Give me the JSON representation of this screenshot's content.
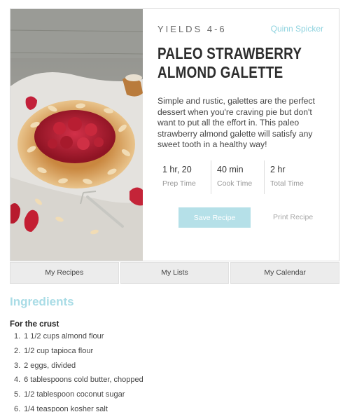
{
  "recipe": {
    "yields": "YIELDS 4-6",
    "author": "Quinn Spicker",
    "title": "PALEO STRAWBERRY ALMOND GALETTE",
    "description": "Simple and rustic, galettes are the perfect dessert when you're craving pie but don't want to put all the effort in. This paleo strawberry almond galette will satisfy any sweet tooth in a healthy way!",
    "photo_icon": "galette-photo"
  },
  "times": [
    {
      "value": "1 hr, 20",
      "label": "Prep Time"
    },
    {
      "value": "40 min",
      "label": "Cook Time"
    },
    {
      "value": "2 hr",
      "label": "Total Time"
    }
  ],
  "actions": {
    "save_label": "Save Recipe",
    "print_label": "Print Recipe"
  },
  "tabs": [
    "My Recipes",
    "My Lists",
    "My Calendar"
  ],
  "ingredients": {
    "heading": "Ingredients",
    "group": "For the crust",
    "items": [
      {
        "num": "1.",
        "text": "1 1/2 cups almond flour"
      },
      {
        "num": "2.",
        "text": "1/2 cup tapioca flour"
      },
      {
        "num": "3.",
        "text": "2 eggs, divided"
      },
      {
        "num": "4.",
        "text": "6 tablespoons cold butter, chopped"
      },
      {
        "num": "5.",
        "text": "1/2 tablespoon coconut sugar"
      },
      {
        "num": "6.",
        "text": "1/4 teaspoon kosher salt"
      }
    ]
  },
  "colors": {
    "accent": "#a9dce6",
    "button": "#b5e0e8",
    "tab_bg": "#ececec"
  }
}
